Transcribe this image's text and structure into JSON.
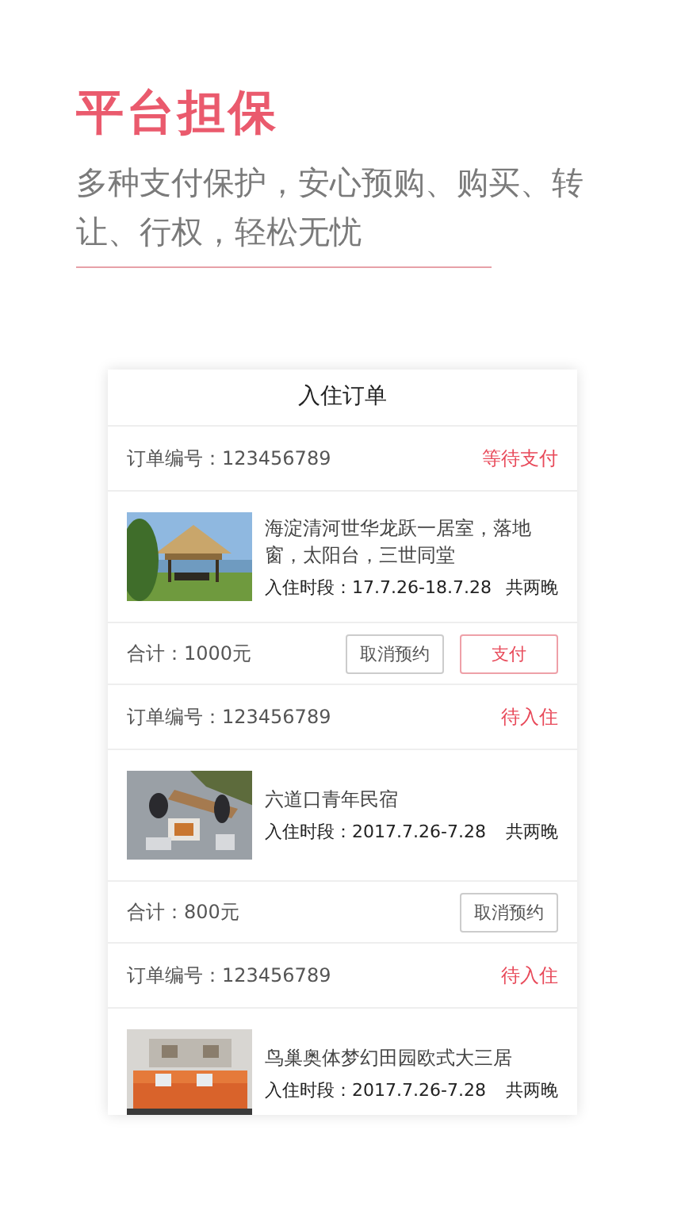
{
  "headline": "平台担保",
  "subtitle": "多种支付保护，安心预购、购买、转让、行权，轻松无忧",
  "card": {
    "title": "入住订单",
    "orders": [
      {
        "order_no": "订单编号：123456789",
        "status": "等待支付",
        "photo": {
          "kind": "picture"
        },
        "name": "海淀清河世华龙跃一居室，落地窗，太阳台，三世同堂",
        "period": "入住时段：17.7.26-18.7.28",
        "nights": "共两晚",
        "total": "合计：1000元",
        "buttons": [
          {
            "label": "取消预约",
            "kind": "outline"
          },
          {
            "label": "支付",
            "kind": "primary"
          }
        ]
      },
      {
        "order_no": "订单编号：123456789",
        "status": "待入住",
        "photo": {
          "kind": "picture"
        },
        "name": "六道口青年民宿",
        "period": "入住时段：2017.7.26-7.28",
        "nights": "共两晚",
        "total": "合计：800元",
        "buttons": [
          {
            "label": "取消预约",
            "kind": "outline"
          }
        ]
      },
      {
        "order_no": "订单编号：123456789",
        "status": "待入住",
        "photo": {
          "kind": "picture"
        },
        "name": "鸟巢奥体梦幻田园欧式大三居",
        "period": "入住时段：2017.7.26-7.28",
        "nights": "共两晚"
      }
    ]
  }
}
